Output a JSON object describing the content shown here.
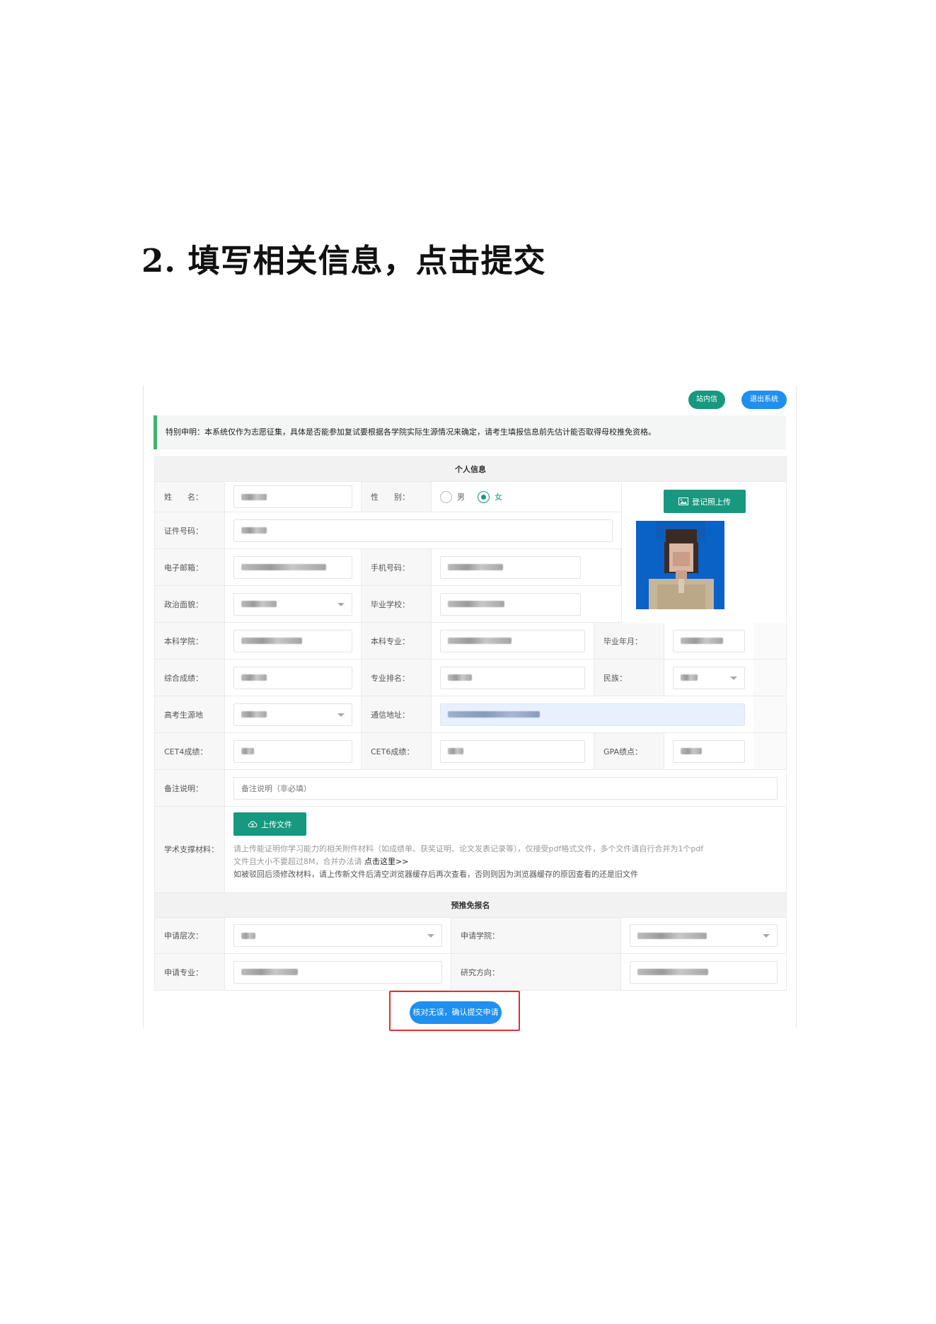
{
  "heading": "2. 填写相关信息，点击提交",
  "topbar": {
    "messages_label": "站内信",
    "logout_label": "退出系统"
  },
  "notice": "特别申明：本系统仅作为志愿征集，具体是否能参加复试要根据各学院实际生源情况来确定，请考生填报信息前先估计能否取得母校推免资格。",
  "personal": {
    "section_title": "个人信息",
    "name_label": "姓　　名：",
    "gender_label": "性　　别：",
    "gender_options": [
      "男",
      "女"
    ],
    "gender_selected": "女",
    "photo_upload_label": "登记照上传",
    "id_label": "证件号码：",
    "email_label": "电子邮箱：",
    "phone_label": "手机号码：",
    "politics_label": "政治面貌：",
    "grad_school_label": "毕业学校：",
    "ug_college_label": "本科学院：",
    "ug_major_label": "本科专业：",
    "grad_date_label": "毕业年月：",
    "score_label": "综合成绩：",
    "rank_label": "专业排名：",
    "ethnicity_label": "民族：",
    "origin_label": "高考生源地",
    "address_label": "通信地址：",
    "cet4_label": "CET4成绩：",
    "cet6_label": "CET6成绩：",
    "gpa_label": "GPA绩点：",
    "remark_label": "备注说明：",
    "remark_placeholder": "备注说明（非必填）",
    "materials_label": "学术支撑材料：",
    "upload_label": "上传文件",
    "upload_help_1": "请上传能证明你学习能力的相关附件材料（如成绩单、获奖证明、论文发表记录等），仅接受pdf格式文件，多个文件请自行合并为1个pdf",
    "upload_help_2": "文件且大小不要超过8M，合并办法请",
    "upload_help_link": "点击这里>>",
    "upload_warn": "如被驳回后须修改材料，请上传新文件后清空浏览器缓存后再次查看，否则则因为浏览器缓存的原因查看的还是旧文件"
  },
  "application": {
    "section_title": "预推免报名",
    "level_label": "申请层次：",
    "college_label": "申请学院：",
    "major_label": "申请专业：",
    "direction_label": "研究方向："
  },
  "submit_label": "核对无误，确认提交申请",
  "colors": {
    "teal": "#16997f",
    "blue": "#1f8ff0",
    "highlight_red": "#e03030"
  }
}
